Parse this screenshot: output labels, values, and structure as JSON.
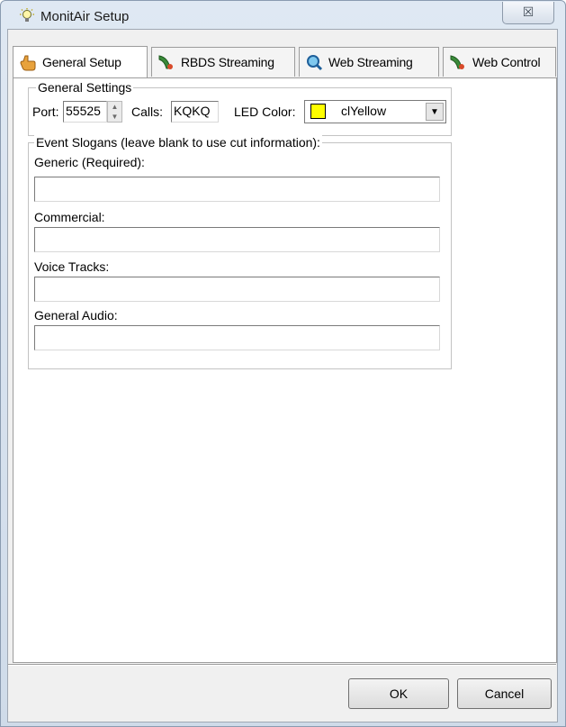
{
  "window": {
    "title": "MonitAir Setup",
    "close_glyph": "☒",
    "icon": "lightbulb-icon"
  },
  "tabs": [
    {
      "label": "General Setup",
      "icon": "hand-pointer-icon",
      "active": true
    },
    {
      "label": "RBDS Streaming",
      "icon": "satellite-dish-icon",
      "active": false
    },
    {
      "label": "Web Streaming",
      "icon": "magnifier-globe-icon",
      "active": false
    },
    {
      "label": "Web Control",
      "icon": "satellite-dish-icon",
      "active": false
    }
  ],
  "general_settings": {
    "legend": "General Settings",
    "port_label": "Port:",
    "port_value": "55525",
    "calls_label": "Calls:",
    "calls_value": "KQKQ",
    "led_color_label": "LED Color:",
    "led_color_value": "clYellow",
    "led_color_swatch": "#ffff00"
  },
  "event_slogans": {
    "legend": "Event Slogans (leave blank to use cut information):",
    "fields": [
      {
        "label": "Generic (Required):",
        "value": ""
      },
      {
        "label": "Commercial:",
        "value": ""
      },
      {
        "label": "Voice Tracks:",
        "value": ""
      },
      {
        "label": "General Audio:",
        "value": ""
      }
    ]
  },
  "buttons": {
    "ok": "OK",
    "cancel": "Cancel"
  }
}
